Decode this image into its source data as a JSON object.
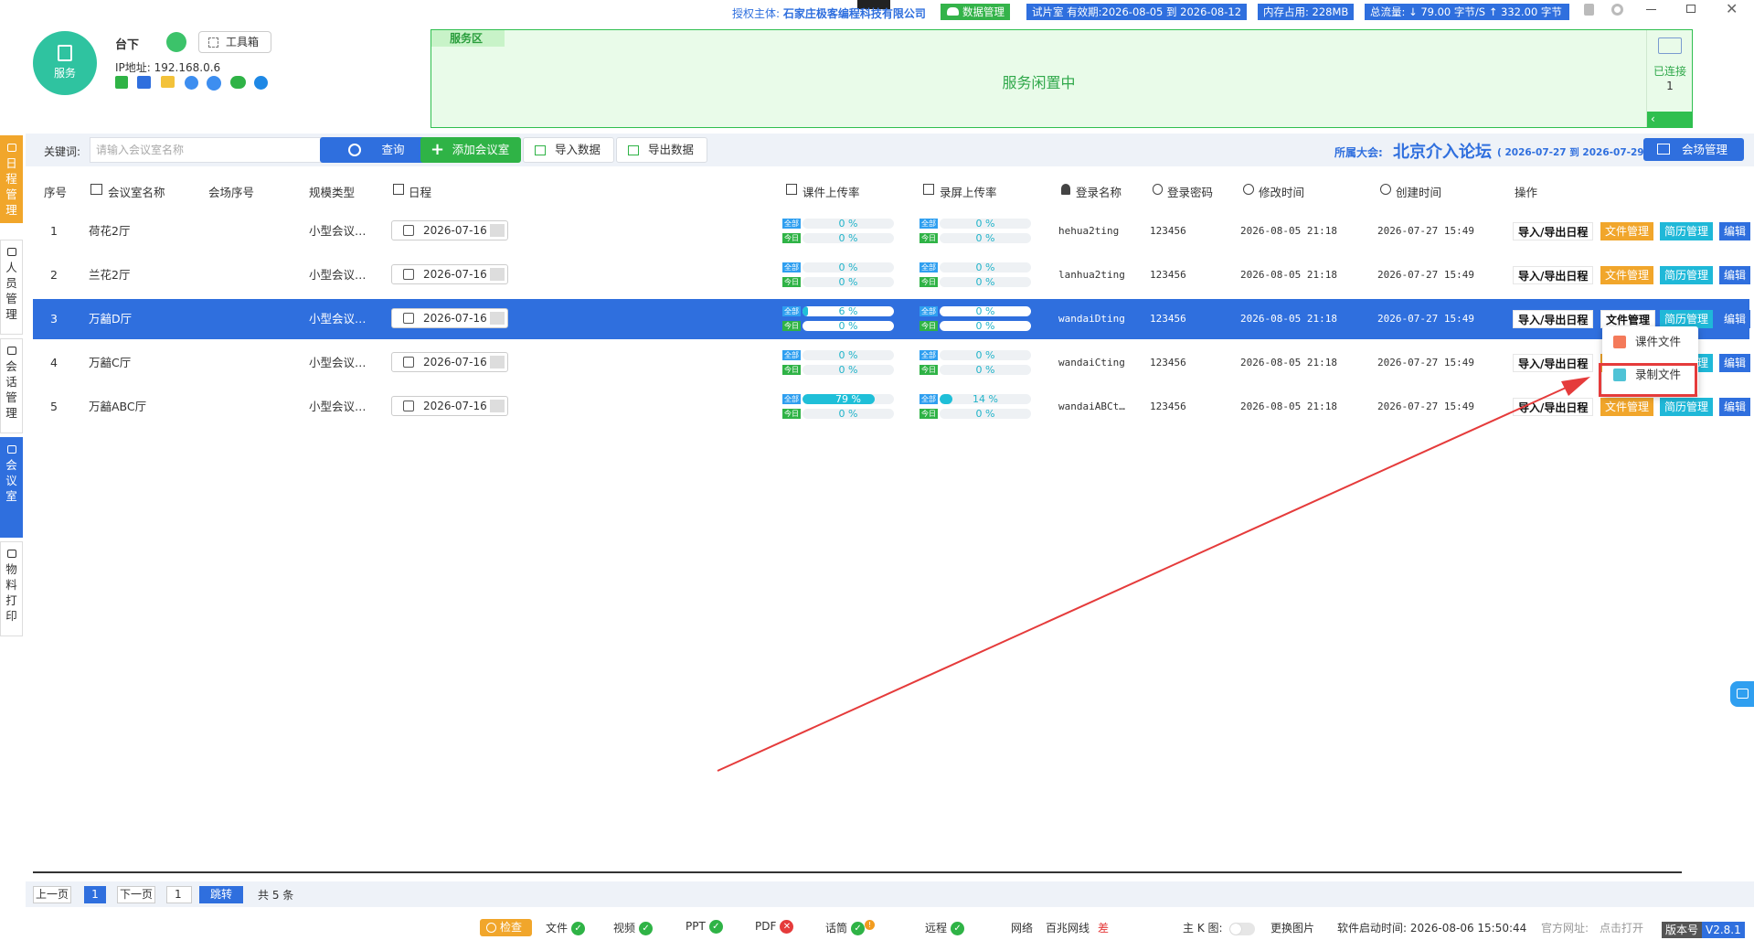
{
  "topbar": {
    "auth_label": "授权主体: ",
    "auth_company": "石家庄极客编程科技有限公司",
    "data_mgmt": "数据管理",
    "trial": "试片室 有效期:2026-08-05 到 2026-08-12",
    "memory": "内存占用:  228MB",
    "traffic": "总流量:  ↓ 79.00 字节/S    ↑ 332.00 字节"
  },
  "header": {
    "service_label": "服务",
    "location": "台下",
    "toolbox": "工具箱",
    "ip": "IP地址: 192.168.0.6",
    "service_area_tag": "服务区",
    "service_status": "服务闲置中",
    "connected_label": "已连接",
    "connected_count": "1"
  },
  "nav": [
    {
      "label": "日程管理",
      "icon": "calendar-icon"
    },
    {
      "label": "人员管理",
      "icon": "people-icon"
    },
    {
      "label": "会话管理",
      "icon": "chat-icon"
    },
    {
      "label": "会议室",
      "icon": "room-icon"
    },
    {
      "label": "物料打印",
      "icon": "printer-icon"
    }
  ],
  "toolbar": {
    "keyword_label": "关键词:",
    "search_placeholder": "请输入会议室名称",
    "query": "查询",
    "add_room": "添加会议室",
    "import": "导入数据",
    "export": "导出数据",
    "conference_label": "所属大会:",
    "conference_name": "北京介入论坛",
    "conference_dates": "( 2026-07-27 到 2026-07-29 )",
    "venue_mgmt": "会场管理"
  },
  "table": {
    "headers": [
      "序号",
      "会议室名称",
      "会场序号",
      "规模类型",
      "日程",
      "课件上传率",
      "录屏上传率",
      "登录名称",
      "登录密码",
      "修改时间",
      "创建时间",
      "操作"
    ],
    "progress_labels": {
      "all": "全部",
      "today": "今日"
    },
    "actions": {
      "io": "导入/导出日程",
      "file": "文件管理",
      "resume": "简历管理",
      "edit": "编辑"
    },
    "rows": [
      {
        "no": "1",
        "name": "荷花2厅",
        "scale": "小型会议…",
        "date": "2026-07-16",
        "cw_all": "0 %",
        "cw_all_val": 0,
        "cw_today": "0 %",
        "rec_all": "0 %",
        "rec_all_val": 0,
        "rec_today": "0 %",
        "login": "hehua2ting",
        "pwd": "123456",
        "modified": "2026-08-05 21:18",
        "created": "2026-07-27 15:49"
      },
      {
        "no": "2",
        "name": "兰花2厅",
        "scale": "小型会议…",
        "date": "2026-07-16",
        "cw_all": "0 %",
        "cw_all_val": 0,
        "cw_today": "0 %",
        "rec_all": "0 %",
        "rec_all_val": 0,
        "rec_today": "0 %",
        "login": "lanhua2ting",
        "pwd": "123456",
        "modified": "2026-08-05 21:18",
        "created": "2026-07-27 15:49"
      },
      {
        "no": "3",
        "name": "万韽D厅",
        "scale": "小型会议…",
        "date": "2026-07-16",
        "cw_all": "6 %",
        "cw_all_val": 6,
        "cw_today": "0 %",
        "rec_all": "0 %",
        "rec_all_val": 0,
        "rec_today": "0 %",
        "login": "wandaiDting",
        "pwd": "123456",
        "modified": "2026-08-05 21:18",
        "created": "2026-07-27 15:49"
      },
      {
        "no": "4",
        "name": "万韽C厅",
        "scale": "小型会议…",
        "date": "2026-07-16",
        "cw_all": "0 %",
        "cw_all_val": 0,
        "cw_today": "0 %",
        "rec_all": "0 %",
        "rec_all_val": 0,
        "rec_today": "0 %",
        "login": "wandaiCting",
        "pwd": "123456",
        "modified": "2026-08-05 21:18",
        "created": "2026-07-27 15:49"
      },
      {
        "no": "5",
        "name": "万韽ABC厅",
        "scale": "小型会议…",
        "date": "2026-07-16",
        "cw_all": "79 %",
        "cw_all_val": 79,
        "cw_today": "0 %",
        "rec_all": "14 %",
        "rec_all_val": 14,
        "rec_today": "0 %",
        "login": "wandaiABCt…",
        "pwd": "123456",
        "modified": "2026-08-05 21:18",
        "created": "2026-07-27 15:49"
      }
    ]
  },
  "dropdown": {
    "courseware": "课件文件",
    "recording": "录制文件"
  },
  "pager": {
    "prev": "上一页",
    "current": "1",
    "next": "下一页",
    "jump_value": "1",
    "jump": "跳转",
    "total": "共 5 条"
  },
  "footer": {
    "check": "检查",
    "file": "文件",
    "video": "视频",
    "ppt": "PPT",
    "pdf": "PDF",
    "mic": "话筒",
    "remote": "远程",
    "network": "网络",
    "network_type": "百兆网线",
    "network_quality": "差",
    "main_k": "主 K 图:",
    "change_image": "更换图片",
    "start_time": "软件启动时间:  2026-08-06 15:50:44",
    "official_site_label": "官方网址:",
    "official_site_link": "点击打开",
    "version_label": "版本号",
    "version": "V2.8.1"
  },
  "colors": {
    "primary": "#2f6fde",
    "green": "#2fb346",
    "orange": "#f1a62b",
    "cyan": "#1fb8d8",
    "highlight_red": "#e53b3b"
  }
}
